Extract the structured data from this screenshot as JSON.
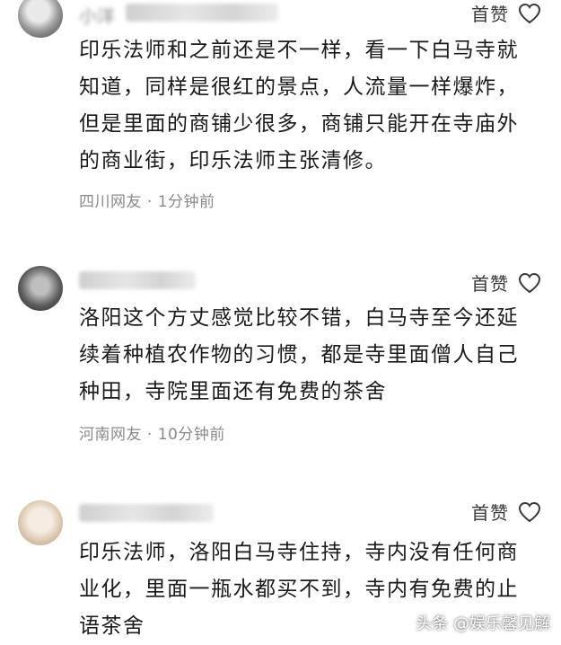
{
  "comments": [
    {
      "username": "小洋",
      "like_label": "首赞",
      "text": "印乐法师和之前还是不一样，看一下白马寺就知道，同样是很红的景点，人流量一样爆炸，但是里面的商铺少很多，商铺只能开在寺庙外的商业街，印乐法师主张清修。",
      "location": "四川网友",
      "time": "1分钟前"
    },
    {
      "username": "",
      "like_label": "首赞",
      "text": "洛阳这个方丈感觉比较不错，白马寺至今还延续着种植农作物的习惯，都是寺里面僧人自己种田，寺院里面还有免费的茶舍",
      "location": "河南网友",
      "time": "10分钟前"
    },
    {
      "username": "",
      "like_label": "首赞",
      "text": "印乐法师，洛阳白马寺住持，寺内没有任何商业化，里面一瓶水都买不到，寺内有免费的止语茶舍",
      "location": "",
      "time": ""
    }
  ],
  "separator": "·",
  "watermark": {
    "text": "头条 @娱乐馨见解",
    "icon": "toutiao-logo-icon"
  },
  "colors": {
    "text": "#1a1a1a",
    "meta": "#8a8a8a",
    "background": "#ffffff"
  }
}
